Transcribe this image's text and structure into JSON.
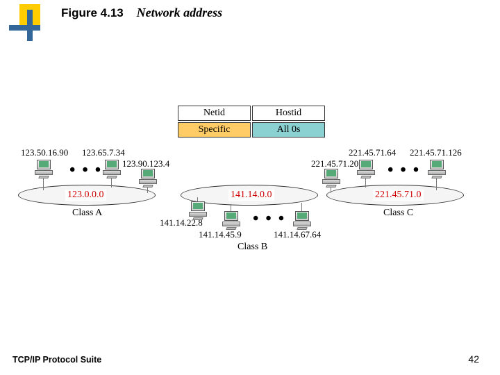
{
  "title": {
    "fig": "Figure 4.13",
    "caption": "Network address"
  },
  "footer": "TCP/IP Protocol Suite",
  "page": "42",
  "table": {
    "h1": "Netid",
    "h2": "Hostid",
    "c1": "Specific",
    "c2": "All 0s"
  },
  "netA": {
    "addr": "123.0.0.0",
    "label": "Class A",
    "hosts": [
      "123.50.16.90",
      "123.65.7.34",
      "123.90.123.4"
    ]
  },
  "netB": {
    "addr": "141.14.0.0",
    "label": "Class B",
    "hosts": [
      "141.14.22.8",
      "141.14.45.9",
      "141.14.67.64"
    ]
  },
  "netC": {
    "addr": "221.45.71.0",
    "label": "Class C",
    "hosts": [
      "221.45.71.64",
      "221.45.71.126",
      "221.45.71.20"
    ]
  },
  "dots": "• • •"
}
